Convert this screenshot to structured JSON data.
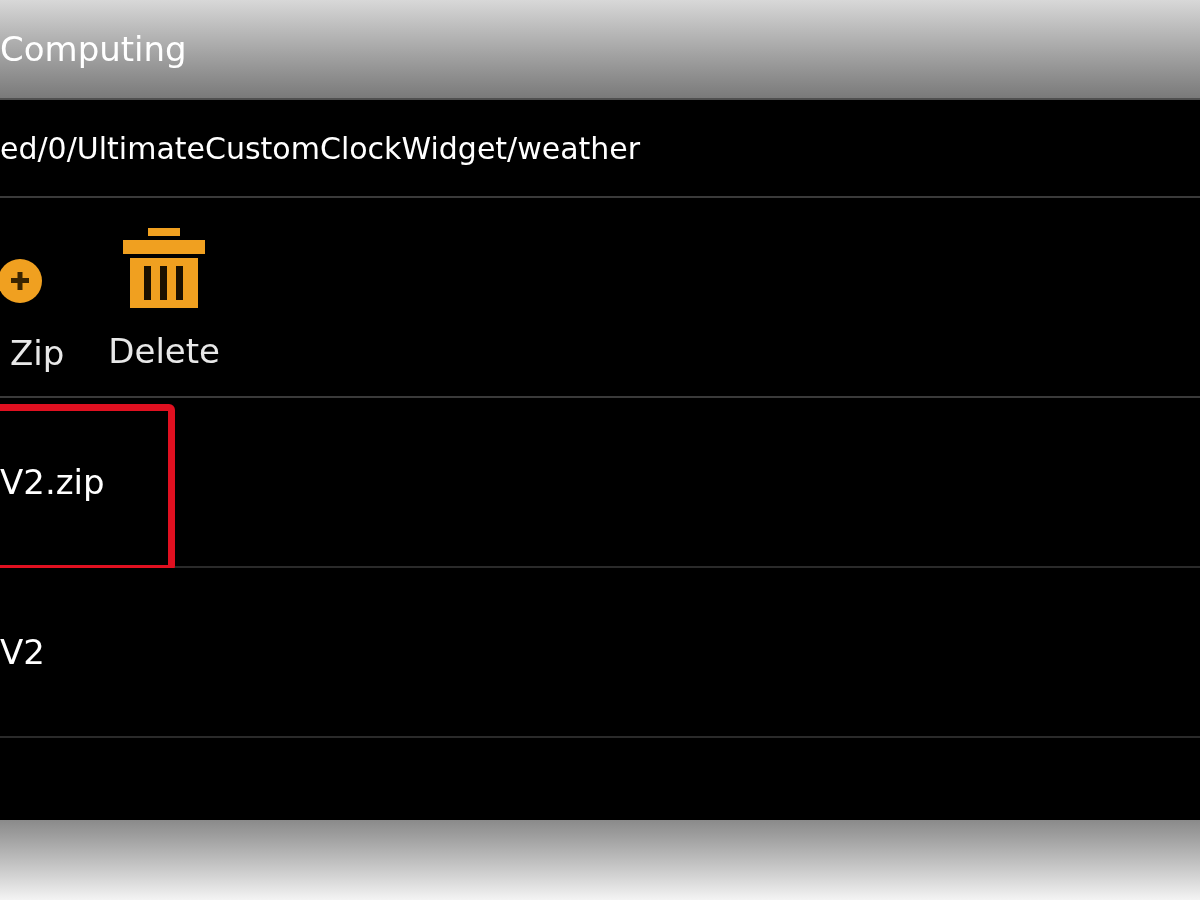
{
  "window": {
    "title": "Computing"
  },
  "path": "ed/0/UltimateCustomClockWidget/weather",
  "toolbar": [
    {
      "kind": "zip",
      "label": "Zip"
    },
    {
      "kind": "delete",
      "label": "Delete"
    }
  ],
  "files": [
    {
      "name": "V2.zip",
      "highlighted": true
    },
    {
      "name": "V2",
      "highlighted": false
    }
  ]
}
